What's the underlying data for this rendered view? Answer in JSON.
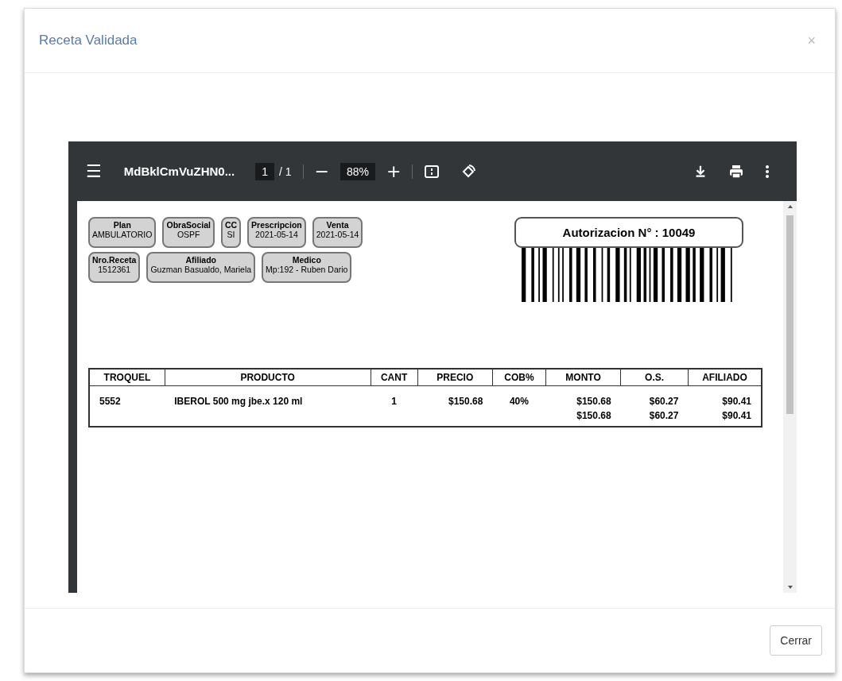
{
  "modal": {
    "title": "Receta Validada",
    "close": "×",
    "footer_button": "Cerrar"
  },
  "viewer": {
    "menu": "☰",
    "filename": "MdBklCmVuZHN0...",
    "page": "1",
    "page_total": "/ 1",
    "zoom_out": "−",
    "zoom": "88%",
    "zoom_in": "+"
  },
  "document": {
    "field_rows": [
      [
        {
          "label": "Plan",
          "value": "AMBULATORIO"
        },
        {
          "label": "ObraSocial",
          "value": "OSPF"
        },
        {
          "label": "CC",
          "value": "SI"
        },
        {
          "label": "Prescripcion",
          "value": "2021-05-14"
        },
        {
          "label": "Venta",
          "value": "2021-05-14"
        }
      ],
      [
        {
          "label": "Nro.Receta",
          "value": "1512361"
        },
        {
          "label": "Afiliado",
          "value": "Guzman Basualdo, Mariela"
        },
        {
          "label": "Medico",
          "value": "Mp:192 - Ruben Dario"
        }
      ]
    ],
    "authorization": "Autorizacion N° : 10049",
    "table": {
      "columns": [
        "TROQUEL",
        "PRODUCTO",
        "CANT",
        "PRECIO",
        "COB%",
        "MONTO",
        "O.S.",
        "AFILIADO"
      ],
      "rows": [
        [
          "5552",
          "IBEROL 500 mg jbe.x 120 ml",
          "1",
          "$150.68",
          "40%",
          "$150.68",
          "$60.27",
          "$90.41"
        ]
      ],
      "totals": [
        "$150.68",
        "$60.27",
        "$90.41"
      ]
    }
  }
}
